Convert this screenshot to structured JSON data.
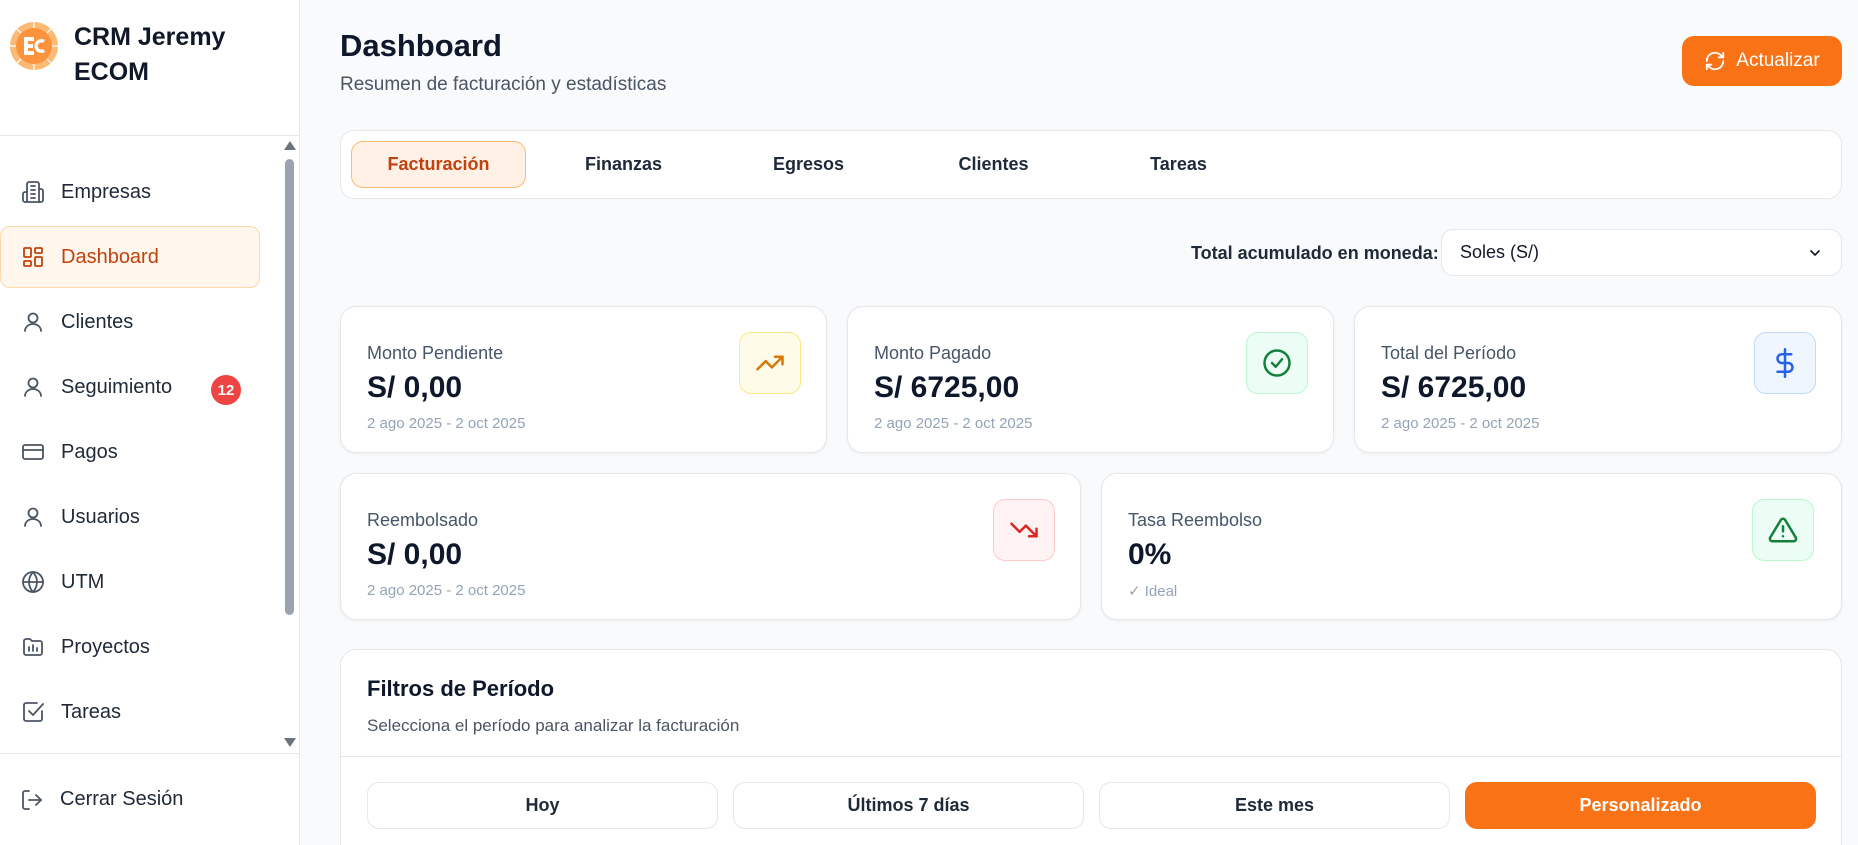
{
  "sidebar": {
    "brand_name": "CRM Jeremy ECOM",
    "items": [
      {
        "label": "Empresas",
        "icon": "building-icon"
      },
      {
        "label": "Dashboard",
        "icon": "dashboard-icon"
      },
      {
        "label": "Clientes",
        "icon": "user-icon"
      },
      {
        "label": "Seguimiento",
        "icon": "user-icon",
        "badge": "12"
      },
      {
        "label": "Pagos",
        "icon": "credit-card-icon"
      },
      {
        "label": "Usuarios",
        "icon": "user-icon"
      },
      {
        "label": "UTM",
        "icon": "globe-icon"
      },
      {
        "label": "Proyectos",
        "icon": "folder-chart-icon"
      },
      {
        "label": "Tareas",
        "icon": "check-square-icon"
      }
    ],
    "active_item": "Dashboard",
    "logout_label": "Cerrar Sesión"
  },
  "header": {
    "title": "Dashboard",
    "subtitle": "Resumen de facturación y estadísticas",
    "refresh_label": "Actualizar"
  },
  "tabs": [
    "Facturación",
    "Finanzas",
    "Egresos",
    "Clientes",
    "Tareas"
  ],
  "active_tab": "Facturación",
  "currency": {
    "label": "Total acumulado en moneda:",
    "selected": "Soles (S/)"
  },
  "cards": [
    {
      "label": "Monto Pendiente",
      "value": "S/ 0,00",
      "sub": "2 ago 2025 - 2 oct 2025",
      "icon": "trending-up-icon",
      "color": "#f59e0b"
    },
    {
      "label": "Monto Pagado",
      "value": "S/ 6725,00",
      "sub": "2 ago 2025 - 2 oct 2025",
      "icon": "check-circle-icon",
      "color": "#16a34a"
    },
    {
      "label": "Total del Período",
      "value": "S/ 6725,00",
      "sub": "2 ago 2025 - 2 oct 2025",
      "icon": "dollar-icon",
      "color": "#2563eb"
    },
    {
      "label": "Reembolsado",
      "value": "S/ 0,00",
      "sub": "2 ago 2025 - 2 oct 2025",
      "icon": "trending-down-icon",
      "color": "#dc2626"
    },
    {
      "label": "Tasa Reembolso",
      "value": "0%",
      "sub": "✓ Ideal",
      "icon": "warning-icon",
      "color": "#16a34a"
    }
  ],
  "filters": {
    "title": "Filtros de Período",
    "subtitle": "Selecciona el período para analizar la facturación",
    "options": [
      "Hoy",
      "Últimos 7 días",
      "Este mes",
      "Personalizado"
    ],
    "active": "Personalizado"
  },
  "colors": {
    "accent": "#f97316",
    "active_bg": "#fff7ed",
    "badge": "#ef4444"
  }
}
